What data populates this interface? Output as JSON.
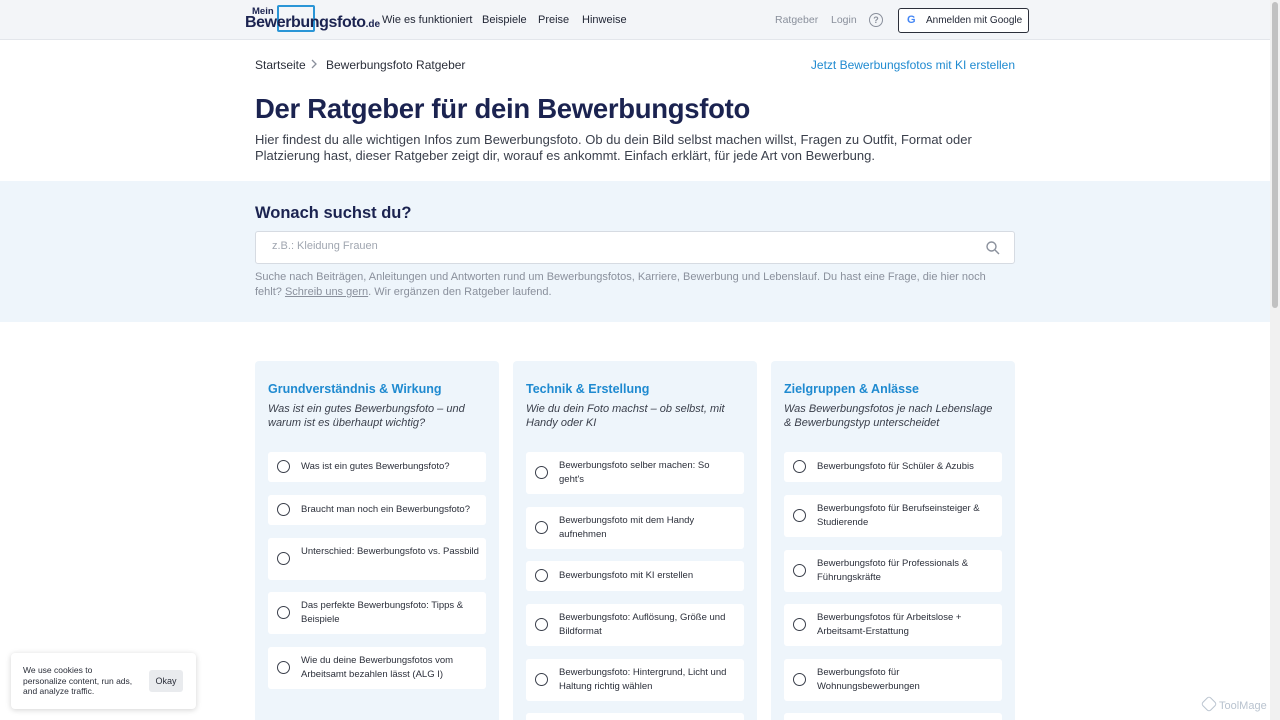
{
  "header": {
    "logo": {
      "small": "Mein",
      "brand": "Bewerbungsfoto",
      "tld": ".de"
    },
    "nav": [
      "Wie es funktioniert",
      "Beispiele",
      "Preise",
      "Hinweise"
    ],
    "right": {
      "ratgeber": "Ratgeber",
      "login": "Login",
      "help_icon": "question-circle-icon",
      "google_label": "Anmelden mit Google"
    }
  },
  "breadcrumb": {
    "home": "Startseite",
    "current": "Bewerbungsfoto Ratgeber"
  },
  "cta_link": "Jetzt Bewerbungsfotos mit KI erstellen",
  "page": {
    "title": "Der Ratgeber für dein Bewerbungsfoto",
    "intro": "Hier findest du alle wichtigen Infos zum Bewerbungsfoto. Ob du dein Bild selbst machen willst, Fragen zu Outfit, Format oder Platzierung hast, dieser Ratgeber zeigt dir, worauf es ankommt. Einfach erklärt, für jede Art von Bewerbung."
  },
  "search": {
    "title": "Wonach suchst du?",
    "placeholder": "z.B.: Kleidung Frauen",
    "hint_before": "Suche nach Beiträgen, Anleitungen und Antworten rund um Bewerbungsfotos, Karriere, Bewerbung und Lebenslauf. Du hast eine Frage, die hier noch fehlt? ",
    "hint_link": "Schreib uns gern",
    "hint_after": ". Wir ergänzen den Ratgeber laufend."
  },
  "categories": [
    {
      "title": "Grundverständnis & Wirkung",
      "subtitle": "Was ist ein gutes Bewerbungsfoto – und warum ist es überhaupt wichtig?",
      "items": [
        "Was ist ein gutes Bewerbungsfoto?",
        "Braucht man noch ein Bewerbungsfoto?",
        "Unterschied: Bewerbungsfoto vs. Passbild",
        "Das perfekte Bewerbungsfoto: Tipps & Beispiele",
        "Wie du deine Bewerbungsfotos vom Arbeitsamt bezahlen lässt (ALG I)"
      ]
    },
    {
      "title": "Technik & Erstellung",
      "subtitle": "Wie du dein Foto machst – ob selbst, mit Handy oder KI",
      "items": [
        "Bewerbungsfoto selber machen: So geht's",
        "Bewerbungsfoto mit dem Handy aufnehmen",
        "Bewerbungsfoto mit KI erstellen",
        "Bewerbungsfoto: Auflösung, Größe und Bildformat",
        "Bewerbungsfoto: Hintergrund, Licht und Haltung richtig wählen"
      ]
    },
    {
      "title": "Zielgruppen & Anlässe",
      "subtitle": "Was Bewerbungsfotos je nach Lebenslage & Bewerbungstyp unterscheidet",
      "items": [
        "Bewerbungsfoto für Schüler & Azubis",
        "Bewerbungsfoto für Berufseinsteiger & Studierende",
        "Bewerbungsfoto für Professionals & Führungskräfte",
        "Bewerbungsfotos für Arbeitslose + Arbeitsamt-Erstattung",
        "Bewerbungsfoto für Wohnungsbewerbungen"
      ]
    }
  ],
  "cookie": {
    "text": "We use cookies to personalize content, run ads, and analyze traffic.",
    "button": "Okay"
  },
  "watermark": "ToolMage",
  "colors": {
    "brand_navy": "#1b2350",
    "accent_blue": "#1f8ad0",
    "band_bg": "#eef5fb"
  }
}
